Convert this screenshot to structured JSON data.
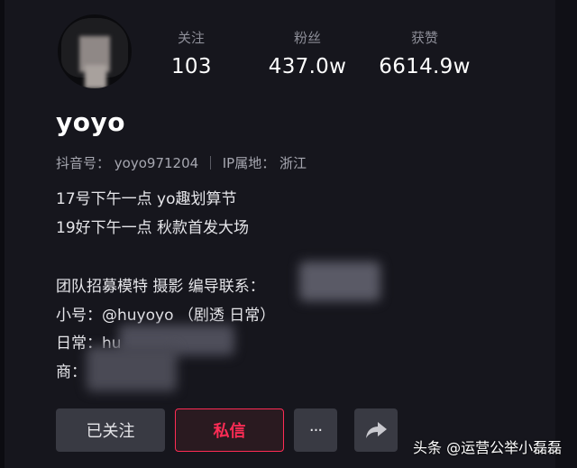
{
  "stats": [
    {
      "label": "关注",
      "value": "103"
    },
    {
      "label": "粉丝",
      "value": "437.0w"
    },
    {
      "label": "获赞",
      "value": "6614.9w"
    }
  ],
  "profile": {
    "username": "yoyo",
    "douyin_id_label": "抖音号：",
    "douyin_id": "yoyo971204",
    "ip_label": "IP属地：",
    "ip_location": "浙江"
  },
  "bio": {
    "line1": "17号下午一点 yo趣划算节",
    "line2": "19好下午一点 秋款首发大场",
    "line3": "团队招募模特 摄影 编导联系：",
    "line4": "小号：@huyoyo （剧透 日常）",
    "line5": "日常：hu",
    "line6": "商："
  },
  "actions": {
    "follow_label": "已关注",
    "message_label": "私信",
    "more_label": "···"
  },
  "watermark": "头条 @运营公举小磊磊",
  "colors": {
    "accent": "#fe2c55",
    "background": "#16161d",
    "button": "#393a43"
  }
}
